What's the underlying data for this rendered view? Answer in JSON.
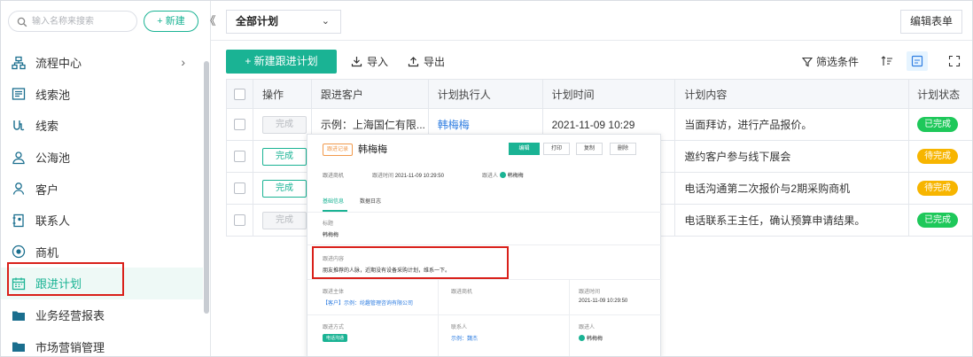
{
  "sidebar": {
    "search_placeholder": "输入名称来搜索",
    "new_label": "+ 新建",
    "collapse_glyph": "《",
    "items": [
      {
        "label": "流程中心",
        "icon": "workflow-icon",
        "has_arrow": true
      },
      {
        "label": "线索池",
        "icon": "lead-pool-icon"
      },
      {
        "label": "线索",
        "icon": "lead-icon"
      },
      {
        "label": "公海池",
        "icon": "public-pool-icon"
      },
      {
        "label": "客户",
        "icon": "customer-icon"
      },
      {
        "label": "联系人",
        "icon": "contact-icon"
      },
      {
        "label": "商机",
        "icon": "opportunity-icon"
      },
      {
        "label": "跟进计划",
        "icon": "calendar-icon",
        "active": true
      },
      {
        "label": "业务经营报表",
        "icon": "folder-icon"
      },
      {
        "label": "市场营销管理",
        "icon": "folder-icon"
      }
    ],
    "arrow_glyph": "›"
  },
  "header": {
    "plan_select": "全部计划",
    "edit_form": "编辑表单"
  },
  "toolbar": {
    "new_plan": "+ 新建跟进计划",
    "import": "导入",
    "export": "导出",
    "filter": "筛选条件"
  },
  "table": {
    "columns": [
      "",
      "操作",
      "跟进客户",
      "计划执行人",
      "计划时间",
      "计划内容",
      "计划状态"
    ],
    "action_label": "完成",
    "rows": [
      {
        "customer": "示例：上海国仁有限...",
        "executor": "韩梅梅",
        "time": "2021-11-09 10:29",
        "content": "当面拜访，进行产品报价。",
        "status": "已完成",
        "status_color": "#1ec85a",
        "action_disabled": true
      },
      {
        "customer": "",
        "executor": "",
        "time": "",
        "content": "邀约客户参与线下展会",
        "status": "待完成",
        "status_color": "#f7b500",
        "action_disabled": false
      },
      {
        "customer": "",
        "executor": "",
        "time": "",
        "content": "电话沟通第二次报价与2期采购商机",
        "status": "待完成",
        "status_color": "#f7b500",
        "action_disabled": false
      },
      {
        "customer": "",
        "executor": "",
        "time": "",
        "content": "电话联系王主任，确认预算申请结果。",
        "status": "已完成",
        "status_color": "#1ec85a",
        "action_disabled": true
      }
    ]
  },
  "popup": {
    "tag": "跟进记录",
    "name": "韩梅梅",
    "buttons": [
      "编辑",
      "打印",
      "复制",
      "删除"
    ],
    "meta": {
      "opportunity_label": "跟进商机",
      "time_label": "跟进时间",
      "time_value": "2021-11-09 10:29:50",
      "person_label": "跟进人",
      "person_value": "韩梅梅"
    },
    "tabs": [
      "基础信息",
      "数据日志"
    ],
    "title_label": "标题",
    "title_value": "韩梅梅",
    "content_label": "跟进内容",
    "content_value": "朋友推荐的人脉，近期没有设备采购计划，维系一下。",
    "subject_label": "跟进主体",
    "subject_value": "【客户】示例：纶趣管理咨询有限公司",
    "opp_label": "跟进商机",
    "time2_label": "跟进时间",
    "time2_value": "2021-11-09 10:29:50",
    "method_label": "跟进方式",
    "method_value": "电话沟通",
    "contact_label": "联系人",
    "contact_value": "示例：魏杰",
    "person2_label": "跟进人",
    "person2_value": "韩梅梅"
  },
  "colors": {
    "accent": "#1ab394",
    "done": "#1ec85a",
    "pending": "#f7b500",
    "highlight": "#d9201a"
  }
}
